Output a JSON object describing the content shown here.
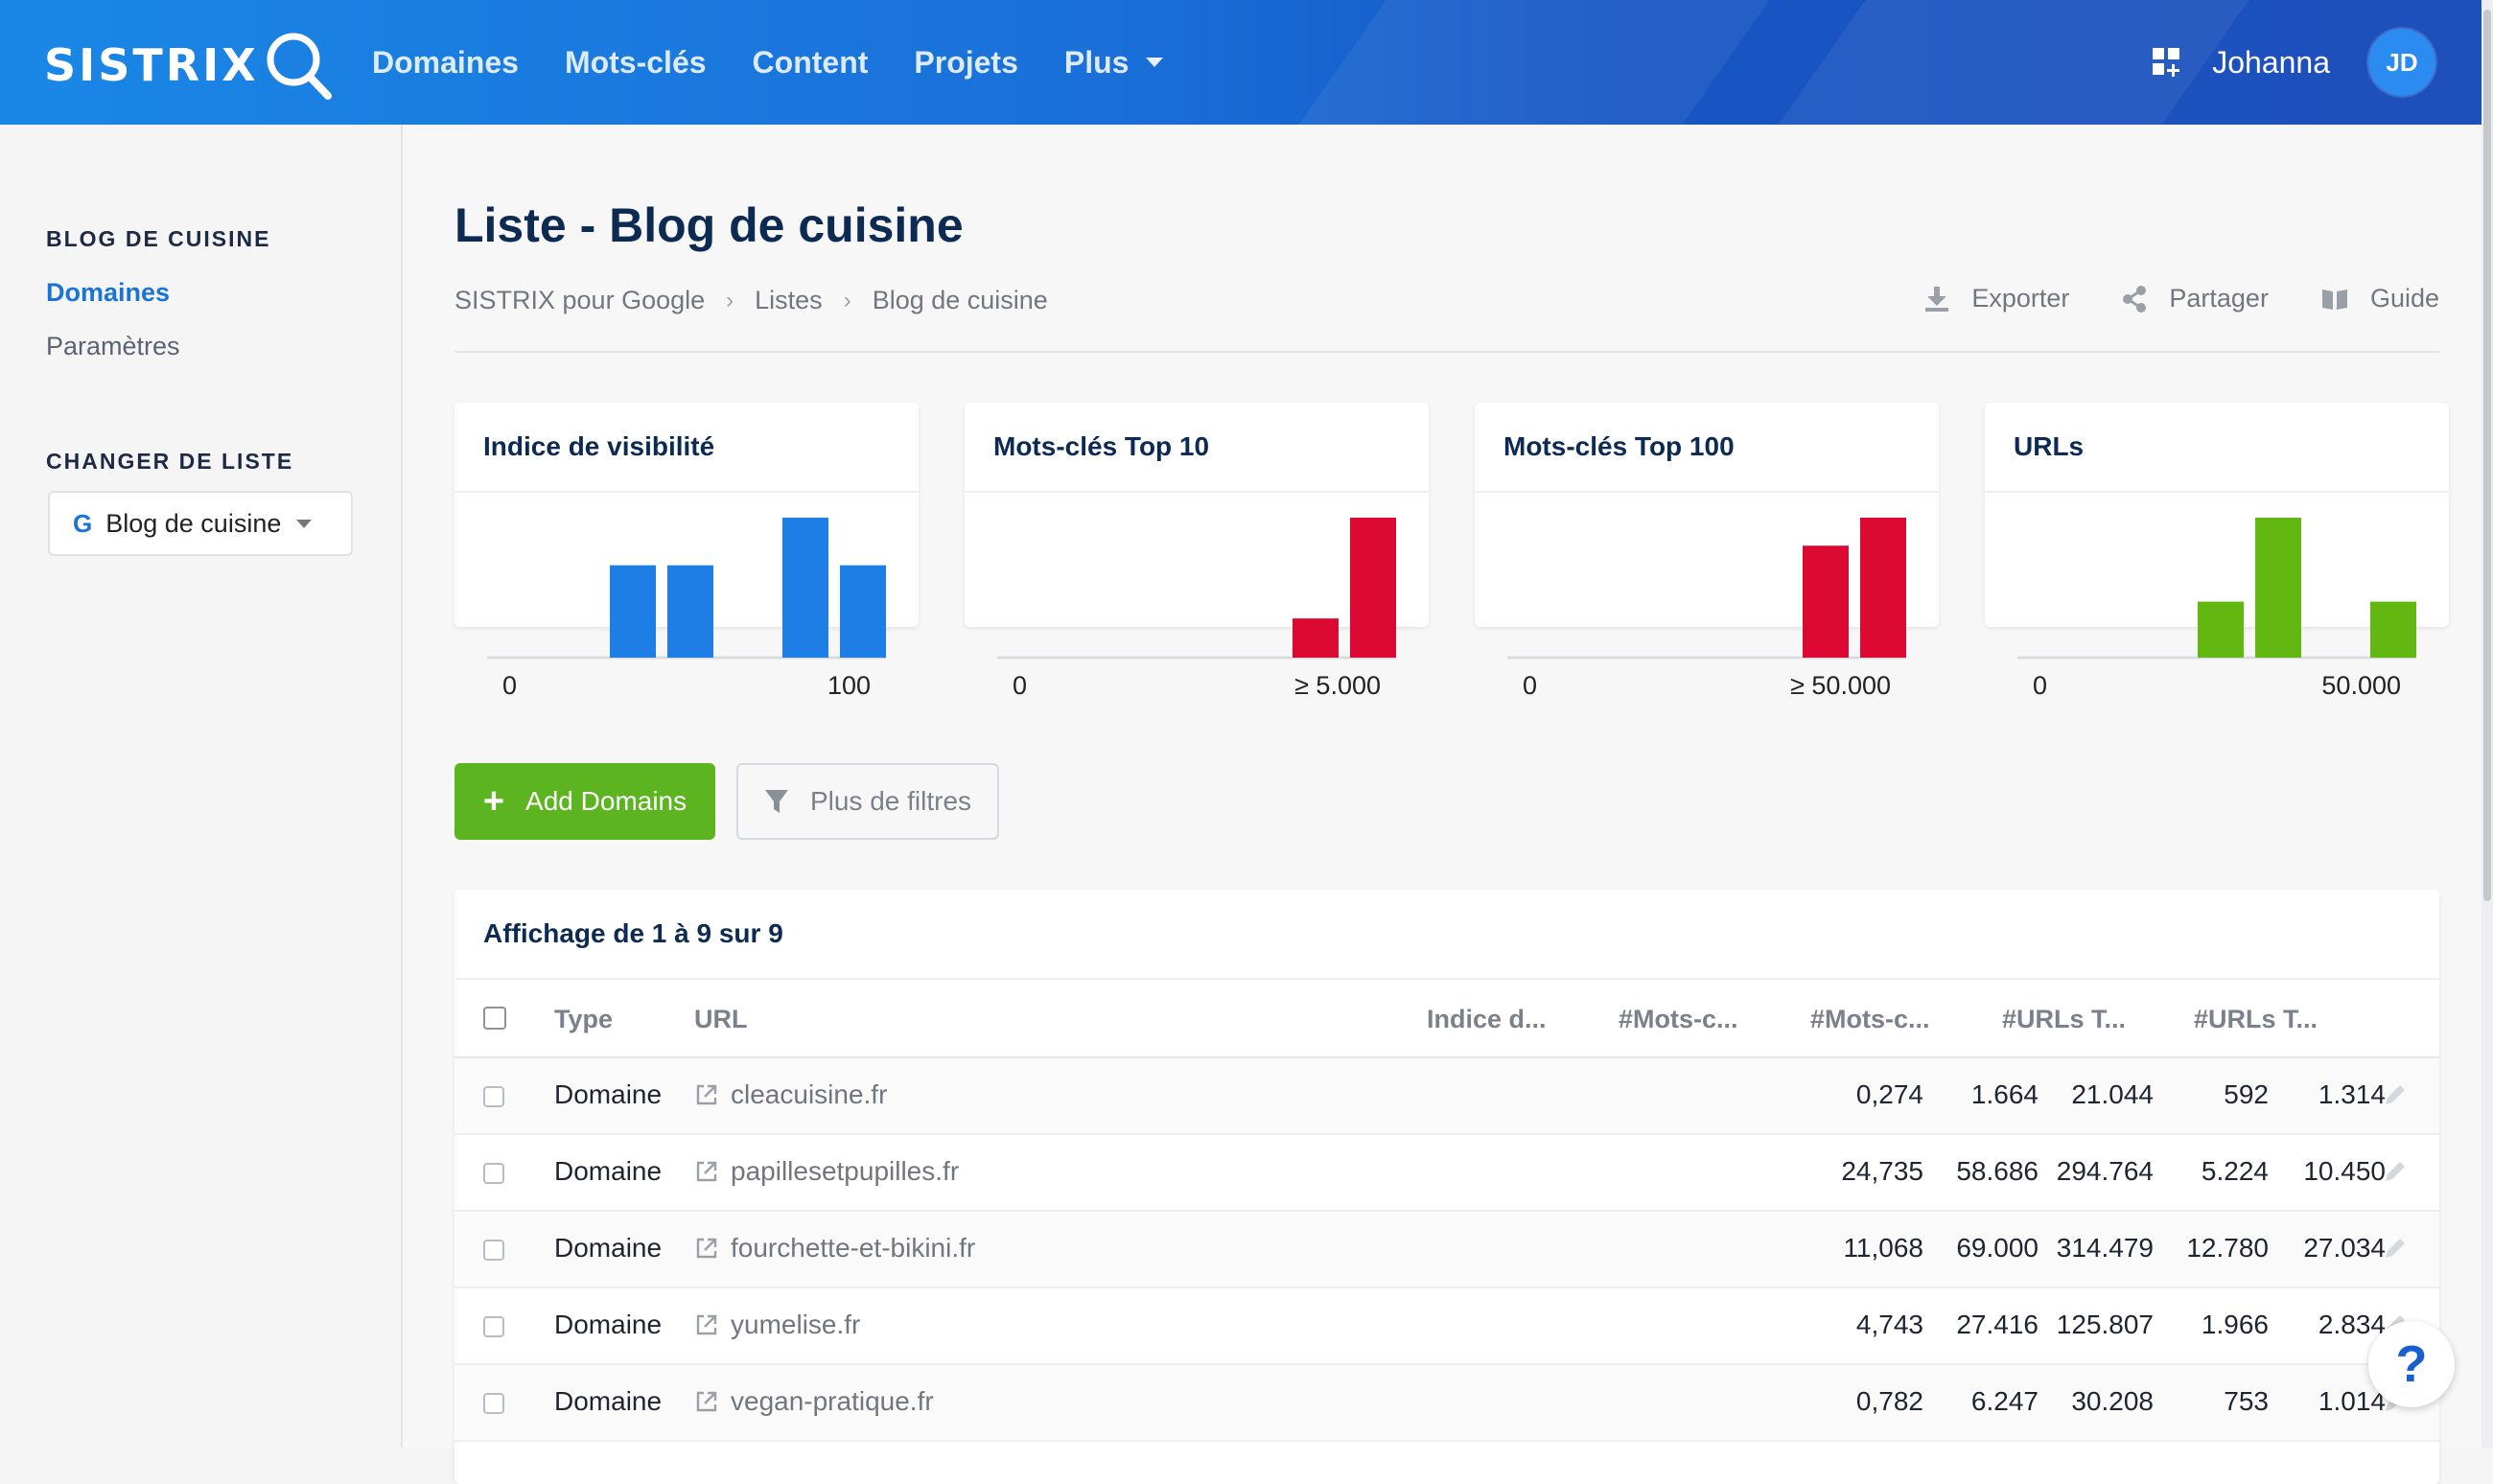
{
  "brand": {
    "logo_text": "SISTRIX"
  },
  "nav": {
    "items": [
      {
        "label": "Domaines"
      },
      {
        "label": "Mots-clés"
      },
      {
        "label": "Content"
      },
      {
        "label": "Projets"
      },
      {
        "label": "Plus"
      }
    ]
  },
  "user": {
    "name": "Johanna",
    "initials": "JD"
  },
  "sidebar": {
    "section1_heading": "BLOG DE CUISINE",
    "links": [
      {
        "label": "Domaines",
        "active": true
      },
      {
        "label": "Paramètres",
        "active": false
      }
    ],
    "section2_heading": "CHANGER DE LISTE",
    "list_select": {
      "icon_letter": "G",
      "value": "Blog de cuisine"
    }
  },
  "page": {
    "title": "Liste - Blog de cuisine",
    "breadcrumb": [
      "SISTRIX pour Google",
      "Listes",
      "Blog de cuisine"
    ],
    "actions": [
      {
        "label": "Exporter",
        "icon": "download-icon"
      },
      {
        "label": "Partager",
        "icon": "share-icon"
      },
      {
        "label": "Guide",
        "icon": "book-icon"
      }
    ]
  },
  "cards": [
    {
      "title": "Indice de visibilité",
      "min_label": "0",
      "max_label": "100",
      "color": "#1f7de6",
      "bins": [
        0,
        0,
        0.66,
        0.66,
        0,
        1.0,
        0.66
      ]
    },
    {
      "title": "Mots-clés Top 10",
      "min_label": "0",
      "max_label": "≥ 5.000",
      "color": "#dc0a32",
      "bins": [
        0,
        0,
        0,
        0,
        0,
        0,
        0.28,
        1.0
      ]
    },
    {
      "title": "Mots-clés Top 100",
      "min_label": "0",
      "max_label": "≥ 50.000",
      "color": "#dc0a32",
      "bins": [
        0,
        0,
        0,
        0,
        0,
        0,
        0.8,
        1.0
      ]
    },
    {
      "title": "URLs",
      "min_label": "0",
      "max_label": "50.000",
      "color": "#62b811",
      "bins": [
        0,
        0,
        0,
        0.4,
        1.0,
        0,
        0.4
      ]
    }
  ],
  "buttons": {
    "add_label": "Add Domains",
    "filter_label": "Plus de filtres"
  },
  "table": {
    "caption": "Affichage de 1 à 9 sur 9",
    "columns": [
      "Type",
      "URL",
      "Indice d...",
      "#Mots-c...",
      "#Mots-c...",
      "#URLs T...",
      "#URLs T..."
    ],
    "rows": [
      {
        "type": "Domaine",
        "url": "cleacuisine.fr",
        "visibility": "0,274",
        "kw10": "1.664",
        "kw100": "21.044",
        "urls10": "592",
        "urls100": "1.314"
      },
      {
        "type": "Domaine",
        "url": "papillesetpupilles.fr",
        "visibility": "24,735",
        "kw10": "58.686",
        "kw100": "294.764",
        "urls10": "5.224",
        "urls100": "10.450"
      },
      {
        "type": "Domaine",
        "url": "fourchette-et-bikini.fr",
        "visibility": "11,068",
        "kw10": "69.000",
        "kw100": "314.479",
        "urls10": "12.780",
        "urls100": "27.034"
      },
      {
        "type": "Domaine",
        "url": "yumelise.fr",
        "visibility": "4,743",
        "kw10": "27.416",
        "kw100": "125.807",
        "urls10": "1.966",
        "urls100": "2.834"
      },
      {
        "type": "Domaine",
        "url": "vegan-pratique.fr",
        "visibility": "0,782",
        "kw10": "6.247",
        "kw100": "30.208",
        "urls10": "753",
        "urls100": "1.014"
      }
    ]
  },
  "help": {
    "label": "?"
  }
}
